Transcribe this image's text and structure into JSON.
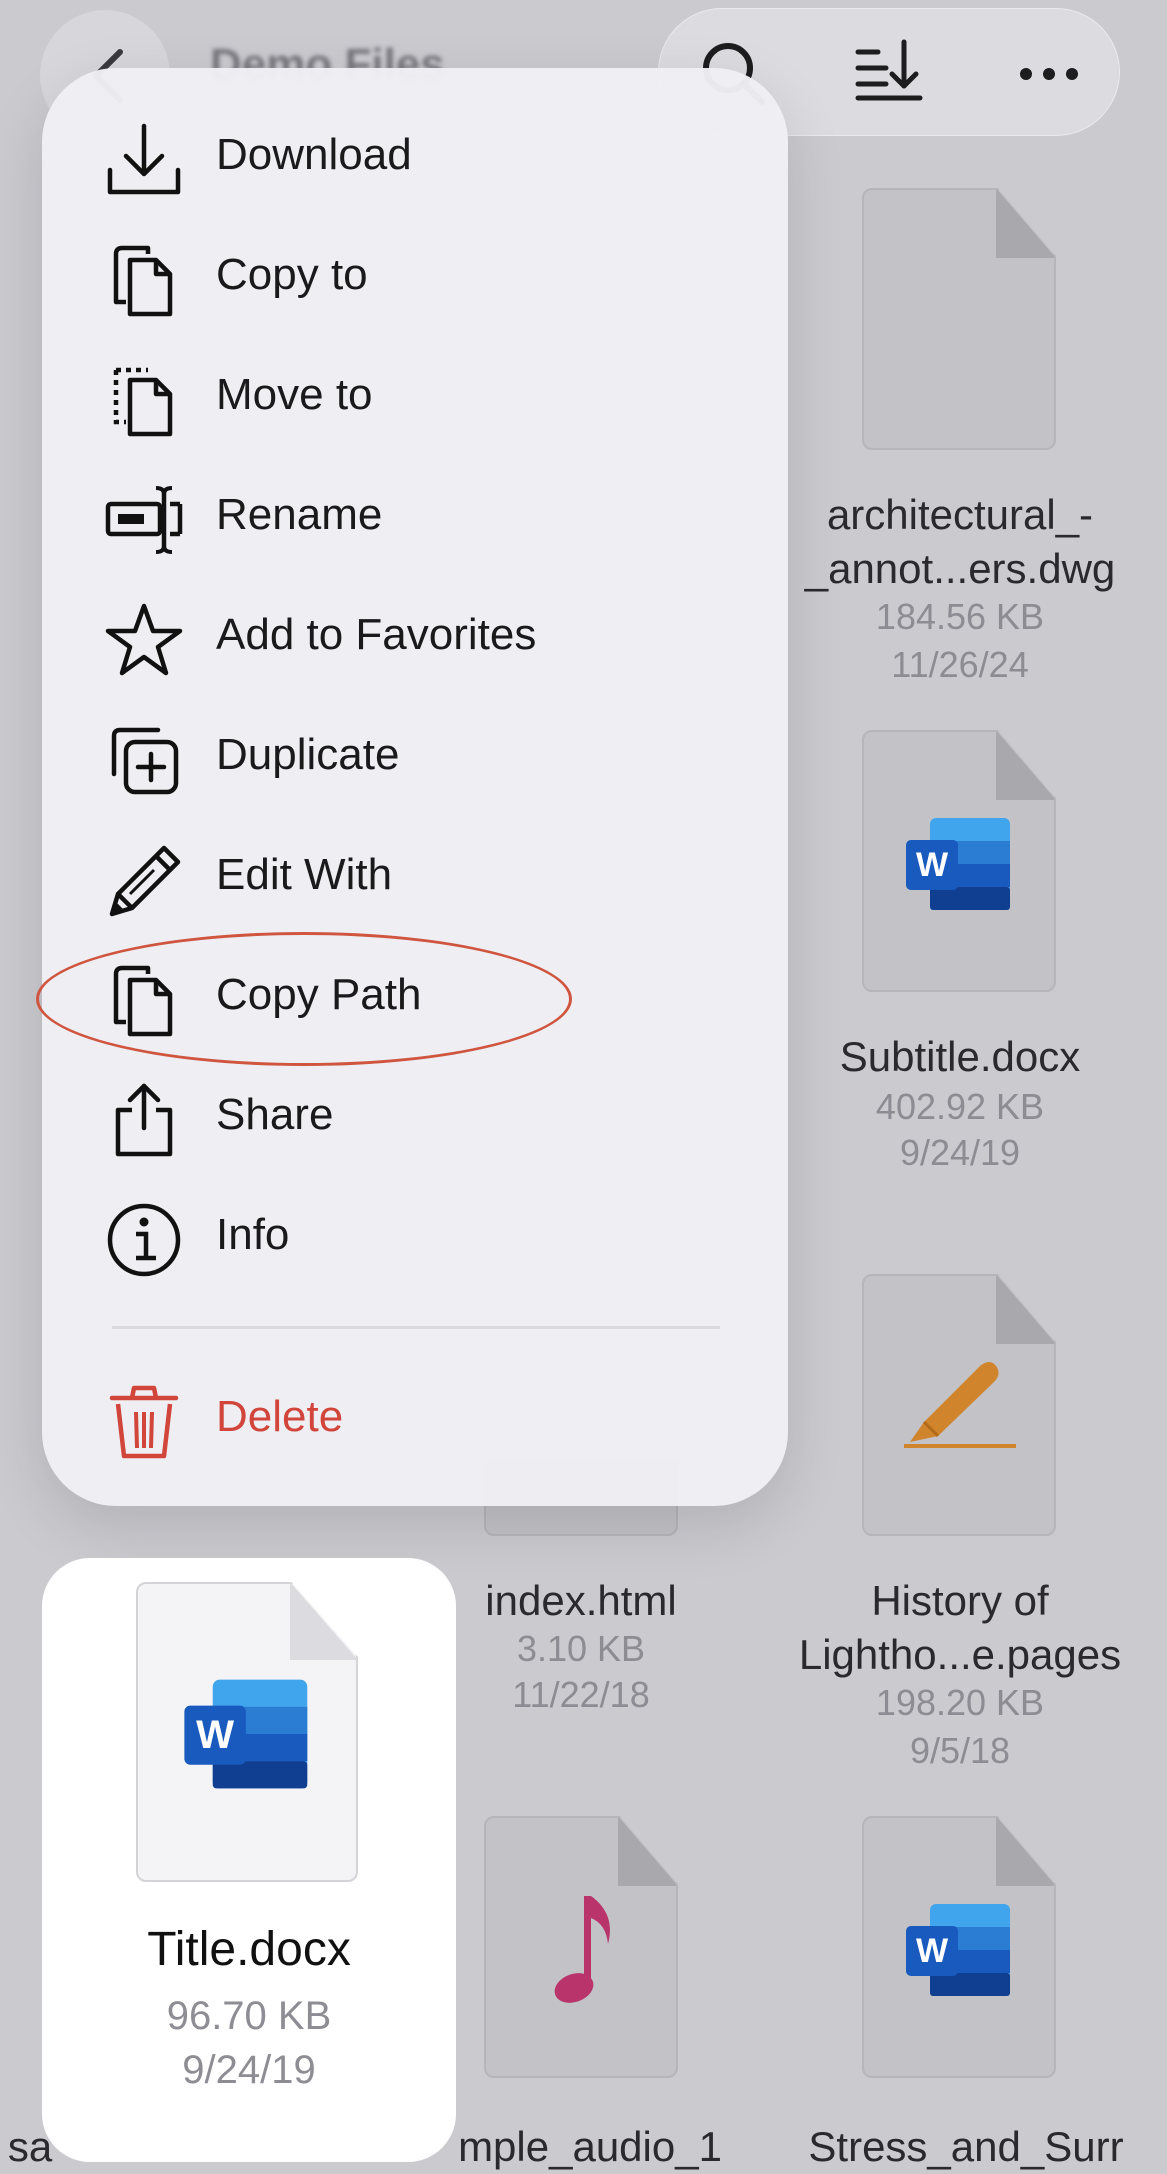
{
  "header": {
    "title": "Demo Files",
    "back_icon": "chevron-left-icon",
    "search_icon": "search-icon",
    "sort_icon": "sort-down-icon",
    "more_icon": "ellipsis-icon"
  },
  "menu": {
    "items": [
      {
        "label": "Download",
        "icon": "download-icon"
      },
      {
        "label": "Copy to",
        "icon": "copy-to-icon"
      },
      {
        "label": "Move to",
        "icon": "move-to-icon"
      },
      {
        "label": "Rename",
        "icon": "rename-icon"
      },
      {
        "label": "Add to Favorites",
        "icon": "star-icon"
      },
      {
        "label": "Duplicate",
        "icon": "duplicate-icon"
      },
      {
        "label": "Edit With",
        "icon": "pencil-icon"
      },
      {
        "label": "Copy Path",
        "icon": "copy-path-icon"
      },
      {
        "label": "Share",
        "icon": "share-icon"
      },
      {
        "label": "Info",
        "icon": "info-icon"
      }
    ],
    "delete": {
      "label": "Delete",
      "icon": "trash-icon"
    },
    "highlighted_item": "Copy Path",
    "colors": {
      "destructive": "#d1453b",
      "highlight_ring": "#d0553f"
    }
  },
  "files": {
    "architectural": {
      "name_line1": "architectural_-",
      "name_line2": "_annot...ers.dwg",
      "size": "184.56 KB",
      "date": "11/26/24"
    },
    "subtitle": {
      "name": "Subtitle.docx",
      "size": "402.92 KB",
      "date": "9/24/19"
    },
    "index": {
      "name": "index.html",
      "size": "3.10 KB",
      "date": "11/22/18"
    },
    "history": {
      "name_line1": "History of",
      "name_line2": "Lightho...e.pages",
      "size": "198.20 KB",
      "date": "9/5/18"
    },
    "bottom_left": {
      "name": "sa"
    },
    "bottom_mid": {
      "name": "mple_audio_1"
    },
    "bottom_right": {
      "name": "Stress_and_Surr"
    }
  },
  "selected_file": {
    "name": "Title.docx",
    "size": "96.70 KB",
    "date": "9/24/19",
    "icon": "word-document-icon"
  },
  "colors": {
    "word_blue": "#2b579a",
    "pages_orange": "#d0842c",
    "audio_pink": "#b8346a"
  }
}
